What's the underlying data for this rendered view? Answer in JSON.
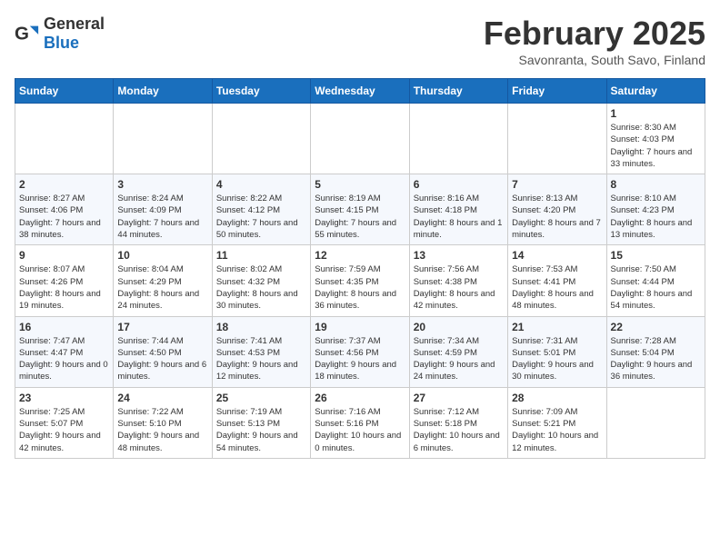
{
  "logo": {
    "general": "General",
    "blue": "Blue"
  },
  "header": {
    "month": "February 2025",
    "location": "Savonranta, South Savo, Finland"
  },
  "weekdays": [
    "Sunday",
    "Monday",
    "Tuesday",
    "Wednesday",
    "Thursday",
    "Friday",
    "Saturday"
  ],
  "weeks": [
    [
      {
        "day": "",
        "info": ""
      },
      {
        "day": "",
        "info": ""
      },
      {
        "day": "",
        "info": ""
      },
      {
        "day": "",
        "info": ""
      },
      {
        "day": "",
        "info": ""
      },
      {
        "day": "",
        "info": ""
      },
      {
        "day": "1",
        "info": "Sunrise: 8:30 AM\nSunset: 4:03 PM\nDaylight: 7 hours and 33 minutes."
      }
    ],
    [
      {
        "day": "2",
        "info": "Sunrise: 8:27 AM\nSunset: 4:06 PM\nDaylight: 7 hours and 38 minutes."
      },
      {
        "day": "3",
        "info": "Sunrise: 8:24 AM\nSunset: 4:09 PM\nDaylight: 7 hours and 44 minutes."
      },
      {
        "day": "4",
        "info": "Sunrise: 8:22 AM\nSunset: 4:12 PM\nDaylight: 7 hours and 50 minutes."
      },
      {
        "day": "5",
        "info": "Sunrise: 8:19 AM\nSunset: 4:15 PM\nDaylight: 7 hours and 55 minutes."
      },
      {
        "day": "6",
        "info": "Sunrise: 8:16 AM\nSunset: 4:18 PM\nDaylight: 8 hours and 1 minute."
      },
      {
        "day": "7",
        "info": "Sunrise: 8:13 AM\nSunset: 4:20 PM\nDaylight: 8 hours and 7 minutes."
      },
      {
        "day": "8",
        "info": "Sunrise: 8:10 AM\nSunset: 4:23 PM\nDaylight: 8 hours and 13 minutes."
      }
    ],
    [
      {
        "day": "9",
        "info": "Sunrise: 8:07 AM\nSunset: 4:26 PM\nDaylight: 8 hours and 19 minutes."
      },
      {
        "day": "10",
        "info": "Sunrise: 8:04 AM\nSunset: 4:29 PM\nDaylight: 8 hours and 24 minutes."
      },
      {
        "day": "11",
        "info": "Sunrise: 8:02 AM\nSunset: 4:32 PM\nDaylight: 8 hours and 30 minutes."
      },
      {
        "day": "12",
        "info": "Sunrise: 7:59 AM\nSunset: 4:35 PM\nDaylight: 8 hours and 36 minutes."
      },
      {
        "day": "13",
        "info": "Sunrise: 7:56 AM\nSunset: 4:38 PM\nDaylight: 8 hours and 42 minutes."
      },
      {
        "day": "14",
        "info": "Sunrise: 7:53 AM\nSunset: 4:41 PM\nDaylight: 8 hours and 48 minutes."
      },
      {
        "day": "15",
        "info": "Sunrise: 7:50 AM\nSunset: 4:44 PM\nDaylight: 8 hours and 54 minutes."
      }
    ],
    [
      {
        "day": "16",
        "info": "Sunrise: 7:47 AM\nSunset: 4:47 PM\nDaylight: 9 hours and 0 minutes."
      },
      {
        "day": "17",
        "info": "Sunrise: 7:44 AM\nSunset: 4:50 PM\nDaylight: 9 hours and 6 minutes."
      },
      {
        "day": "18",
        "info": "Sunrise: 7:41 AM\nSunset: 4:53 PM\nDaylight: 9 hours and 12 minutes."
      },
      {
        "day": "19",
        "info": "Sunrise: 7:37 AM\nSunset: 4:56 PM\nDaylight: 9 hours and 18 minutes."
      },
      {
        "day": "20",
        "info": "Sunrise: 7:34 AM\nSunset: 4:59 PM\nDaylight: 9 hours and 24 minutes."
      },
      {
        "day": "21",
        "info": "Sunrise: 7:31 AM\nSunset: 5:01 PM\nDaylight: 9 hours and 30 minutes."
      },
      {
        "day": "22",
        "info": "Sunrise: 7:28 AM\nSunset: 5:04 PM\nDaylight: 9 hours and 36 minutes."
      }
    ],
    [
      {
        "day": "23",
        "info": "Sunrise: 7:25 AM\nSunset: 5:07 PM\nDaylight: 9 hours and 42 minutes."
      },
      {
        "day": "24",
        "info": "Sunrise: 7:22 AM\nSunset: 5:10 PM\nDaylight: 9 hours and 48 minutes."
      },
      {
        "day": "25",
        "info": "Sunrise: 7:19 AM\nSunset: 5:13 PM\nDaylight: 9 hours and 54 minutes."
      },
      {
        "day": "26",
        "info": "Sunrise: 7:16 AM\nSunset: 5:16 PM\nDaylight: 10 hours and 0 minutes."
      },
      {
        "day": "27",
        "info": "Sunrise: 7:12 AM\nSunset: 5:18 PM\nDaylight: 10 hours and 6 minutes."
      },
      {
        "day": "28",
        "info": "Sunrise: 7:09 AM\nSunset: 5:21 PM\nDaylight: 10 hours and 12 minutes."
      },
      {
        "day": "",
        "info": ""
      }
    ]
  ]
}
